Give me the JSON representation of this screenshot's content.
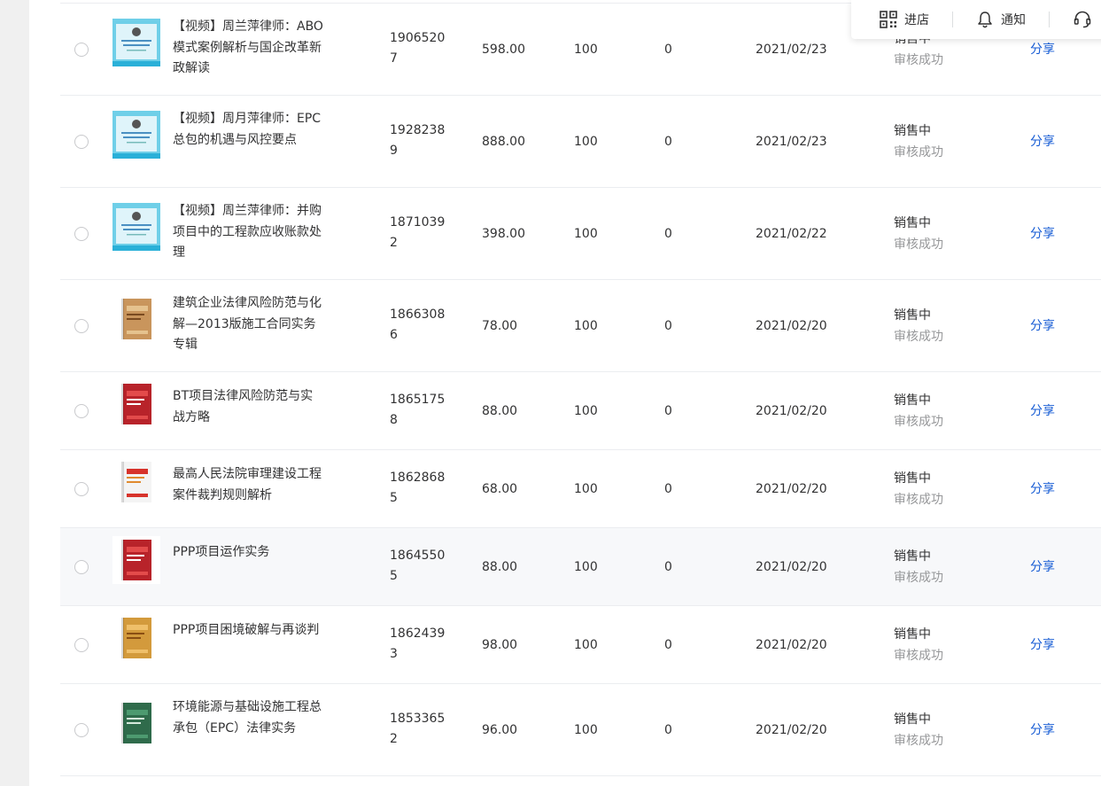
{
  "toolbar": {
    "store_label": "进店",
    "notify_label": "通知"
  },
  "rows": [
    {
      "name": "【视频】周兰萍律师：ABO模式案例解析与国企改革新政解读",
      "id": "19065207",
      "price": "598.00",
      "stock": "100",
      "sales": "0",
      "date": "2021/02/23",
      "status": "销售中",
      "audit": "审核成功",
      "share": "分享"
    },
    {
      "name": "【视频】周月萍律师：EPC总包的机遇与风控要点",
      "id": "19282389",
      "price": "888.00",
      "stock": "100",
      "sales": "0",
      "date": "2021/02/23",
      "status": "销售中",
      "audit": "审核成功",
      "share": "分享"
    },
    {
      "name": "【视频】周兰萍律师：并购项目中的工程款应收账款处理",
      "id": "18710392",
      "price": "398.00",
      "stock": "100",
      "sales": "0",
      "date": "2021/02/22",
      "status": "销售中",
      "audit": "审核成功",
      "share": "分享"
    },
    {
      "name": "建筑企业法律风险防范与化解—2013版施工合同实务专辑",
      "id": "18663086",
      "price": "78.00",
      "stock": "100",
      "sales": "0",
      "date": "2021/02/20",
      "status": "销售中",
      "audit": "审核成功",
      "share": "分享"
    },
    {
      "name": "BT项目法律风险防范与实战方略",
      "id": "18651758",
      "price": "88.00",
      "stock": "100",
      "sales": "0",
      "date": "2021/02/20",
      "status": "销售中",
      "audit": "审核成功",
      "share": "分享"
    },
    {
      "name": "最高人民法院审理建设工程案件裁判规则解析",
      "id": "18628685",
      "price": "68.00",
      "stock": "100",
      "sales": "0",
      "date": "2021/02/20",
      "status": "销售中",
      "audit": "审核成功",
      "share": "分享"
    },
    {
      "name": "PPP项目运作实务",
      "id": "18645505",
      "price": "88.00",
      "stock": "100",
      "sales": "0",
      "date": "2021/02/20",
      "status": "销售中",
      "audit": "审核成功",
      "share": "分享"
    },
    {
      "name": "PPP项目困境破解与再谈判",
      "id": "18624393",
      "price": "98.00",
      "stock": "100",
      "sales": "0",
      "date": "2021/02/20",
      "status": "销售中",
      "audit": "审核成功",
      "share": "分享"
    },
    {
      "name": "环境能源与基础设施工程总承包（EPC）法律实务",
      "id": "18533652",
      "price": "96.00",
      "stock": "100",
      "sales": "0",
      "date": "2021/02/20",
      "status": "销售中",
      "audit": "审核成功",
      "share": "分享"
    }
  ],
  "thumb_types": [
    "video-cover",
    "video-cover",
    "video-cover",
    "book-cover-brown",
    "book-cover-red",
    "book-cover-white-red",
    "book-cover-red",
    "book-cover-orange",
    "book-cover-green"
  ]
}
